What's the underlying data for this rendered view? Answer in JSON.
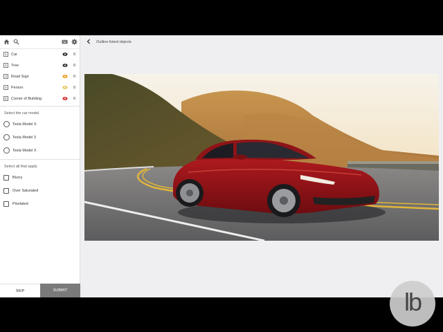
{
  "sidebar": {
    "labels": [
      {
        "num": "1",
        "name": "Car",
        "count": "0",
        "color": "#333333"
      },
      {
        "num": "2",
        "name": "Tree",
        "count": "0",
        "color": "#333333"
      },
      {
        "num": "3",
        "name": "Road Sign",
        "count": "0",
        "color": "#e8a020"
      },
      {
        "num": "4",
        "name": "Person",
        "count": "0",
        "color": "#e8c860"
      },
      {
        "num": "5",
        "name": "Corner of Building",
        "count": "0",
        "color": "#d03030"
      }
    ],
    "model_question": "Select the car model",
    "models": [
      "Tesla Model S",
      "Tesla Model 3",
      "Tesla Model X"
    ],
    "apply_question": "Select all that apply",
    "checks": [
      "Blurry",
      "Over Saturated",
      "Pixelated"
    ],
    "skip_label": "SKIP",
    "submit_label": "SUBMIT"
  },
  "main": {
    "title": "Outline listed objects"
  },
  "watermark": {
    "text": "lb"
  }
}
